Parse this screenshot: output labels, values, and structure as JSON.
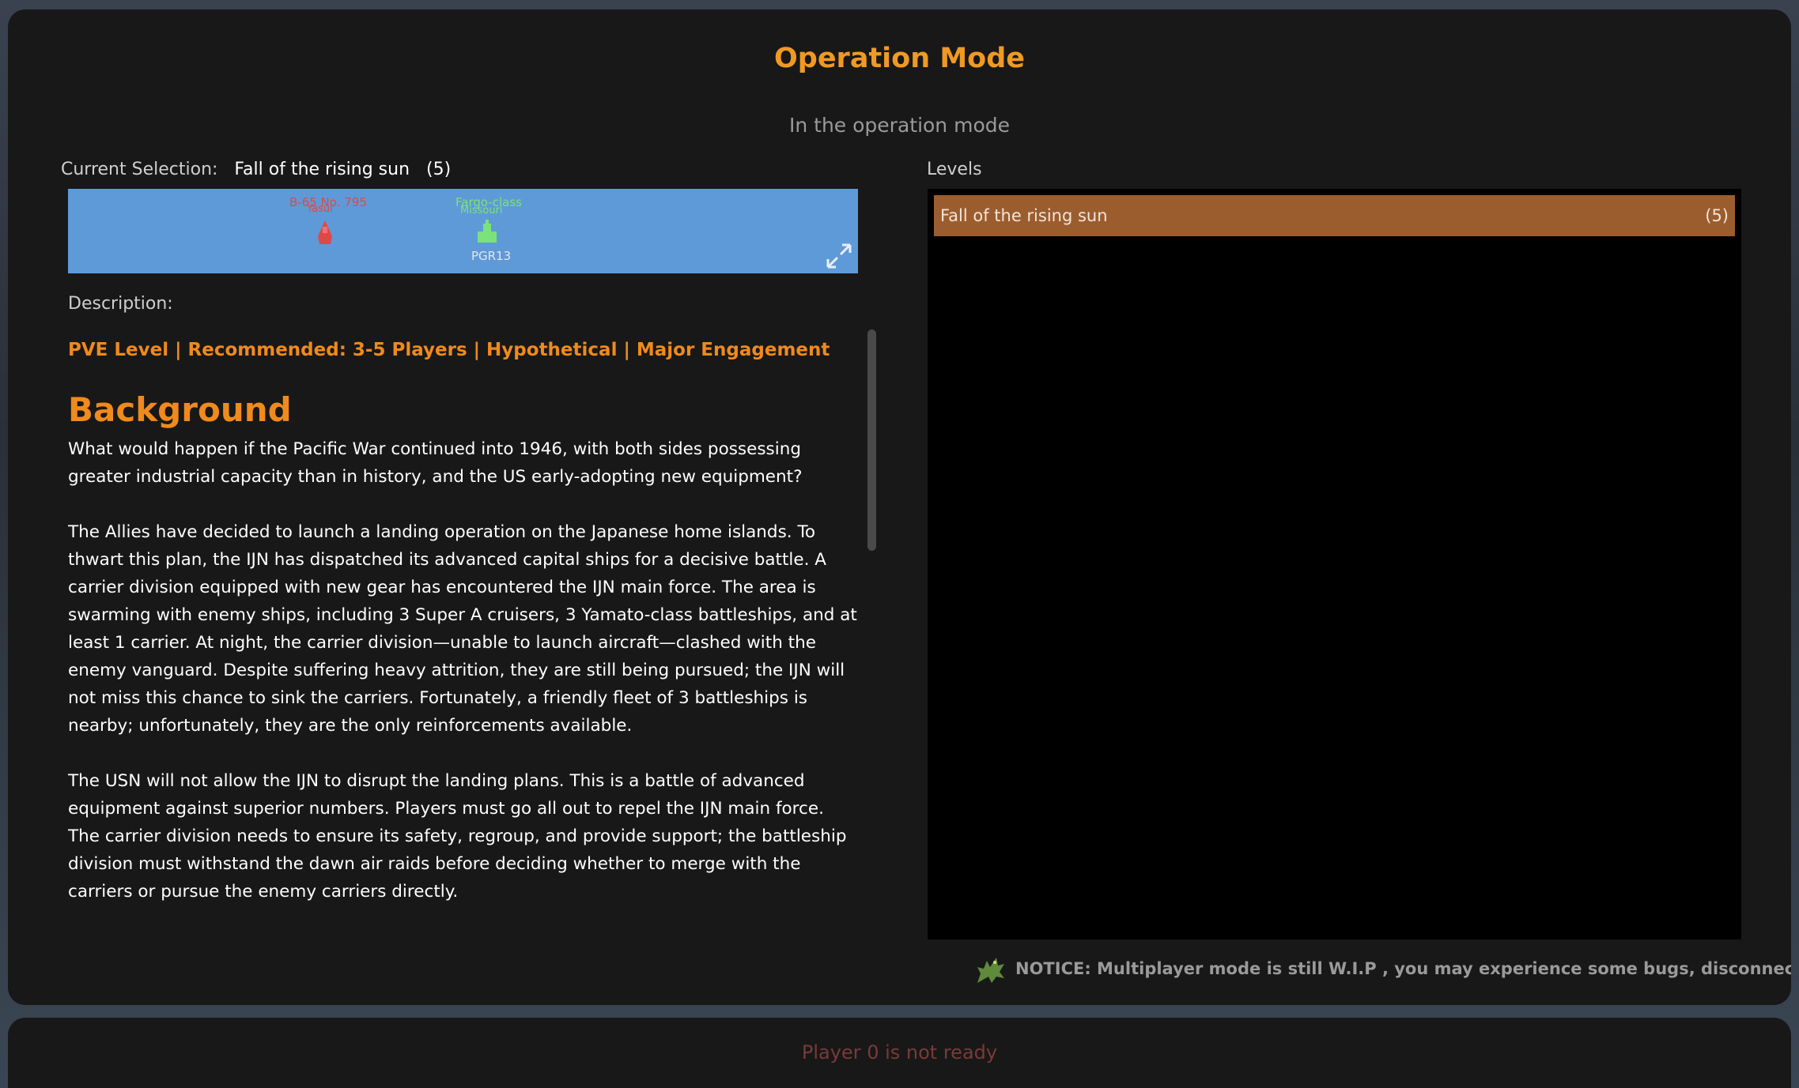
{
  "header": {
    "title": "Operation Mode",
    "subtitle": "In the operation mode"
  },
  "selection": {
    "label": "Current Selection:",
    "value": "Fall of the rising sun",
    "count": "(5)"
  },
  "map_preview": {
    "enemy_label_1": "B-65 No. 795",
    "enemy_label_2": "Yasui",
    "friend_label_1": "Fargo-class",
    "friend_label_2": "Missouri",
    "hull_label": "PGR13",
    "enemy_color": "#e04848",
    "friend_color": "#7be27b"
  },
  "description": {
    "label": "Description:",
    "tags": "PVE Level | Recommended: 3-5 Players | Hypothetical | Major Engagement",
    "heading": "Background",
    "paragraphs": [
      "What would happen if the Pacific War continued into 1946, with both sides possessing greater industrial capacity than in history, and the US early-adopting new equipment?",
      "The Allies have decided to launch a landing operation on the Japanese home islands. To thwart this plan, the IJN has dispatched its advanced capital ships for a decisive battle. A carrier division equipped with new gear has encountered the IJN main force. The area is swarming with enemy ships, including 3 Super A cruisers, 3 Yamato-class battleships, and at least 1 carrier. At night, the carrier division—unable to launch aircraft—clashed with the enemy vanguard. Despite suffering heavy attrition, they are still being pursued; the IJN will not miss this chance to sink the carriers. Fortunately, a friendly fleet of 3 battleships is nearby; unfortunately, they are the only reinforcements available.",
      "The USN will not allow the IJN to disrupt the landing plans. This is a battle of advanced equipment against superior numbers. Players must go all out to repel the IJN main force. The carrier division needs to ensure its safety, regroup, and provide support; the battleship division must withstand the dawn air raids before deciding whether to merge with the carriers or pursue the enemy carriers directly."
    ]
  },
  "levels": {
    "label": "Levels",
    "items": [
      {
        "name": "Fall of the rising sun",
        "count": "(5)"
      }
    ]
  },
  "notice": {
    "text": "NOTICE: Multiplayer mode is still W.I.P , you may experience some bugs, disconnections"
  },
  "footer": {
    "status": "Player 0 is not ready"
  },
  "colors": {
    "accent": "#f09a22",
    "level_selected": "#9c5d2e",
    "panel": "#181818"
  }
}
